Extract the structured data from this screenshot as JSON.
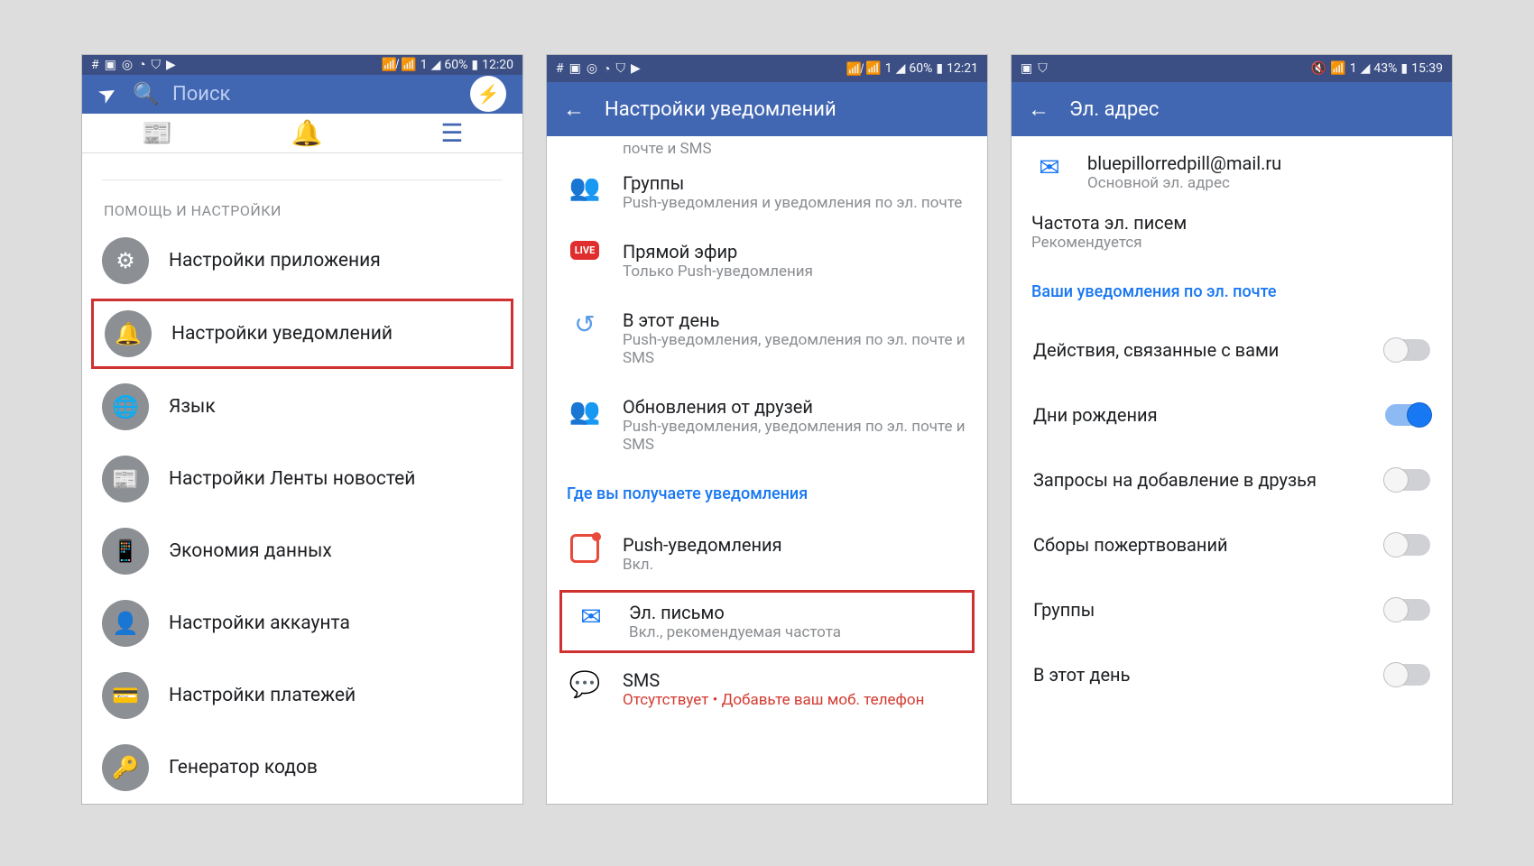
{
  "statusbar1": {
    "battery": "60%",
    "time": "12:20"
  },
  "statusbar2": {
    "battery": "60%",
    "time": "12:21"
  },
  "statusbar3": {
    "battery": "43%",
    "time": "15:39"
  },
  "screen1": {
    "search_placeholder": "Поиск",
    "section": "ПОМОЩЬ И НАСТРОЙКИ",
    "items": [
      {
        "label": "Настройки приложения",
        "icon": "gear"
      },
      {
        "label": "Настройки уведомлений",
        "icon": "bell",
        "highlighted": true
      },
      {
        "label": "Язык",
        "icon": "globe"
      },
      {
        "label": "Настройки Ленты новостей",
        "icon": "feed"
      },
      {
        "label": "Экономия данных",
        "icon": "phone"
      },
      {
        "label": "Настройки аккаунта",
        "icon": "account"
      },
      {
        "label": "Настройки платежей",
        "icon": "card"
      },
      {
        "label": "Генератор кодов",
        "icon": "key"
      }
    ]
  },
  "screen2": {
    "title": "Настройки уведомлений",
    "partial_sub": "почте и SMS",
    "settings": [
      {
        "title": "Группы",
        "sub": "Push-уведомления и уведомления по эл. почте",
        "icon": "👥",
        "color": "#f7b928"
      },
      {
        "title": "Прямой эфир",
        "sub": "Только Push-уведомления",
        "icon": "LIVE",
        "color": "#e02d2d",
        "isBadge": true
      },
      {
        "title": "В этот день",
        "sub": "Push-уведомления, уведомления по эл. почте и SMS",
        "icon": "↺",
        "color": "#5a9be6"
      },
      {
        "title": "Обновления от друзей",
        "sub": "Push-уведомления, уведомления по эл. почте и SMS",
        "icon": "👥",
        "color": "#3169c1"
      }
    ],
    "where_header": "Где вы получаете уведомления",
    "channels": [
      {
        "title": "Push-уведомления",
        "sub": "Вкл.",
        "icon": "◻",
        "color": "#e84b3c",
        "dot": true
      },
      {
        "title": "Эл. письмо",
        "sub": "Вкл., рекомендуемая частота",
        "icon": "✉",
        "color": "#1877f2",
        "highlighted": true
      },
      {
        "title": "SMS",
        "sub": "Отсутствует • ",
        "sub_red": "Добавьте ваш моб. телефон",
        "icon": "💬",
        "color": "#3fb84f"
      }
    ]
  },
  "screen3": {
    "title": "Эл. адрес",
    "email": "bluepillorredpill@mail.ru",
    "email_sub": "Основной эл. адрес",
    "freq_title": "Частота эл. писем",
    "freq_sub": "Рекомендуется",
    "section": "Ваши уведомления по эл. почте",
    "toggles": [
      {
        "label": "Действия, связанные с вами",
        "on": false
      },
      {
        "label": "Дни рождения",
        "on": true
      },
      {
        "label": "Запросы на добавление в друзья",
        "on": false
      },
      {
        "label": "Сборы пожертвований",
        "on": false
      },
      {
        "label": "Группы",
        "on": false
      },
      {
        "label": "В этот день",
        "on": false
      }
    ]
  }
}
